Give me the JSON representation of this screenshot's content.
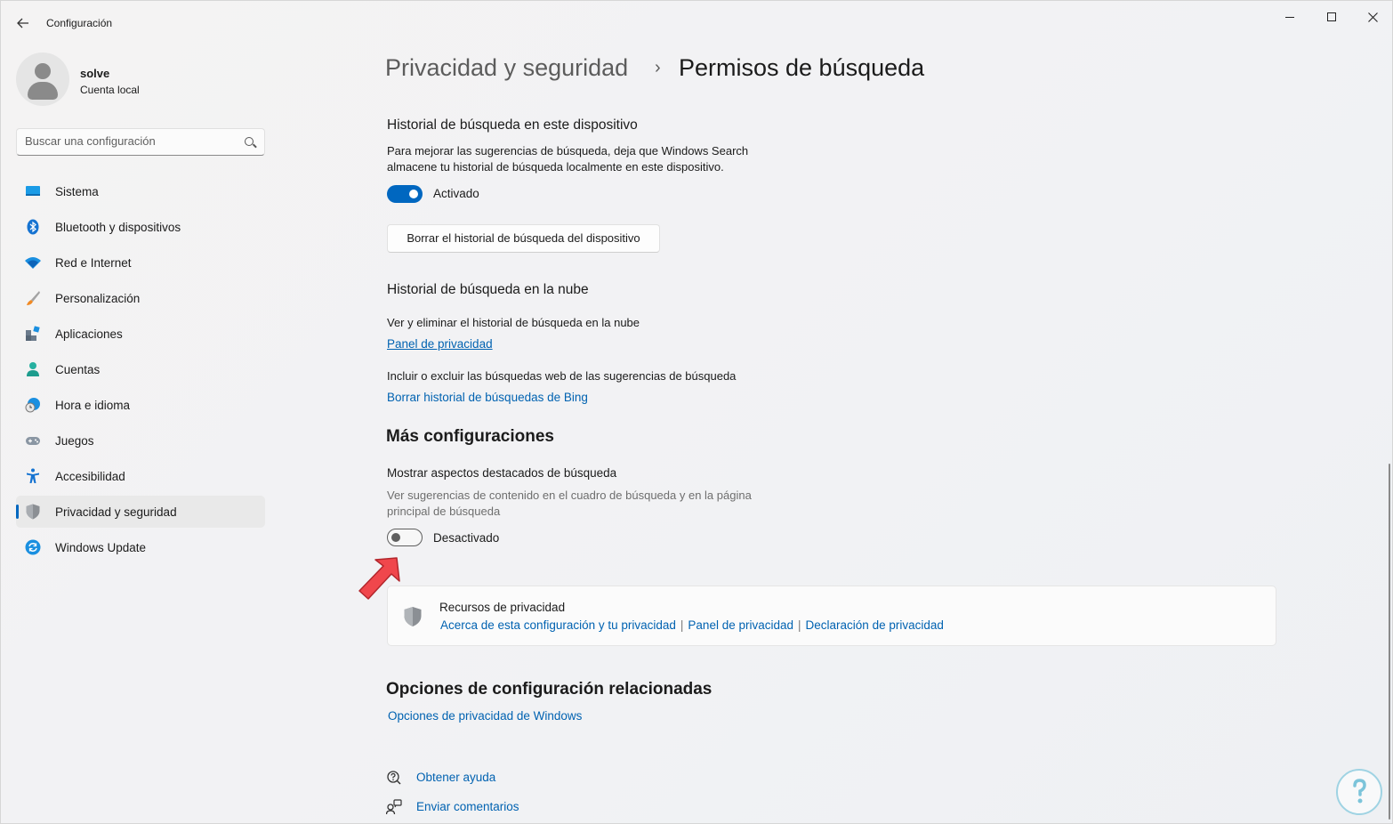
{
  "window": {
    "app_title": "Configuración",
    "back_icon": "arrow-left-icon",
    "controls": [
      "minimize-icon",
      "maximize-icon",
      "close-icon"
    ]
  },
  "profile": {
    "name": "solve",
    "account_type": "Cuenta local"
  },
  "search": {
    "placeholder": "Buscar una configuración"
  },
  "sidebar": {
    "items": [
      {
        "label": "Sistema",
        "icon": "system-icon"
      },
      {
        "label": "Bluetooth y dispositivos",
        "icon": "bluetooth-icon"
      },
      {
        "label": "Red e Internet",
        "icon": "wifi-icon"
      },
      {
        "label": "Personalización",
        "icon": "brush-icon"
      },
      {
        "label": "Aplicaciones",
        "icon": "apps-icon"
      },
      {
        "label": "Cuentas",
        "icon": "account-icon"
      },
      {
        "label": "Hora e idioma",
        "icon": "clock-globe-icon"
      },
      {
        "label": "Juegos",
        "icon": "gamepad-icon"
      },
      {
        "label": "Accesibilidad",
        "icon": "accessibility-icon"
      },
      {
        "label": "Privacidad y seguridad",
        "icon": "shield-icon",
        "active": true
      },
      {
        "label": "Windows Update",
        "icon": "update-icon"
      }
    ]
  },
  "breadcrumb": {
    "parent": "Privacidad y seguridad",
    "separator": "›",
    "current": "Permisos de búsqueda"
  },
  "device_history": {
    "title": "Historial de búsqueda en este dispositivo",
    "description": "Para mejorar las sugerencias de búsqueda, deja que Windows Search almacene tu historial de búsqueda localmente en este dispositivo.",
    "toggle_state": "on",
    "toggle_label": "Activado",
    "clear_button": "Borrar el historial de búsqueda del dispositivo"
  },
  "cloud_history": {
    "title": "Historial de búsqueda en la nube",
    "view_text": "Ver y eliminar el historial de búsqueda en la nube",
    "view_link": "Panel de privacidad",
    "include_text": "Incluir o excluir las búsquedas web de las sugerencias de búsqueda",
    "bing_link": "Borrar historial de búsquedas de Bing"
  },
  "more_settings": {
    "title": "Más configuraciones",
    "highlights_title": "Mostrar aspectos destacados de búsqueda",
    "highlights_desc": "Ver sugerencias de contenido en el cuadro de búsqueda y en la página principal de búsqueda",
    "toggle_state": "off",
    "toggle_label": "Desactivado"
  },
  "privacy_resources": {
    "title": "Recursos de privacidad",
    "links": [
      "Acerca de esta configuración y tu privacidad",
      "Panel de privacidad",
      "Declaración de privacidad"
    ],
    "separator": "|"
  },
  "related": {
    "title": "Opciones de configuración relacionadas",
    "link": "Opciones de privacidad de Windows"
  },
  "footer": {
    "help": "Obtener ayuda",
    "feedback": "Enviar comentarios"
  },
  "colors": {
    "accent": "#0067c0",
    "link": "#0062b1",
    "annotation_arrow": "#f0474c"
  }
}
